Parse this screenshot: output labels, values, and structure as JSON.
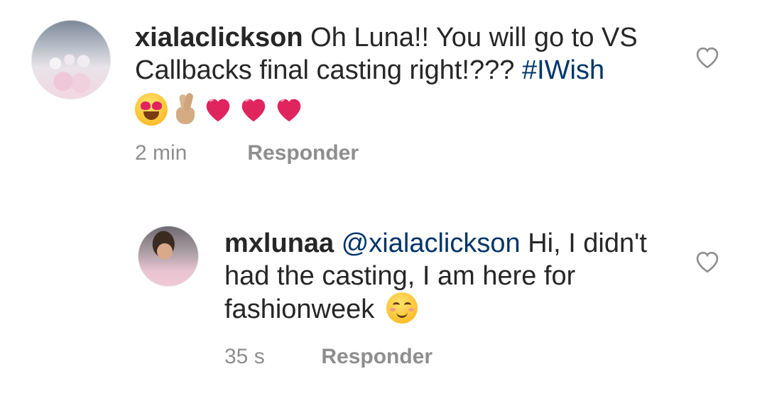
{
  "comments": [
    {
      "username": "xialaclickson",
      "text": "Oh Luna!! You will go to VS Callbacks final casting right!???",
      "hashtag": "#IWish",
      "emojis": [
        "heart-eyes-face",
        "crossed-fingers",
        "red-heart",
        "red-heart",
        "red-heart"
      ],
      "time": "2 min",
      "reply_label": "Responder"
    },
    {
      "username": "mxlunaa",
      "mention": "@xialaclickson",
      "text": "Hi, I didn't had the casting, I am here for fashionweek",
      "emoji": "smiling-face-with-smiling-eyes",
      "time": "35 s",
      "reply_label": "Responder"
    }
  ],
  "colors": {
    "text": "#262626",
    "link": "#003569",
    "meta": "#8e8e8e",
    "heart": "#e0245e"
  }
}
